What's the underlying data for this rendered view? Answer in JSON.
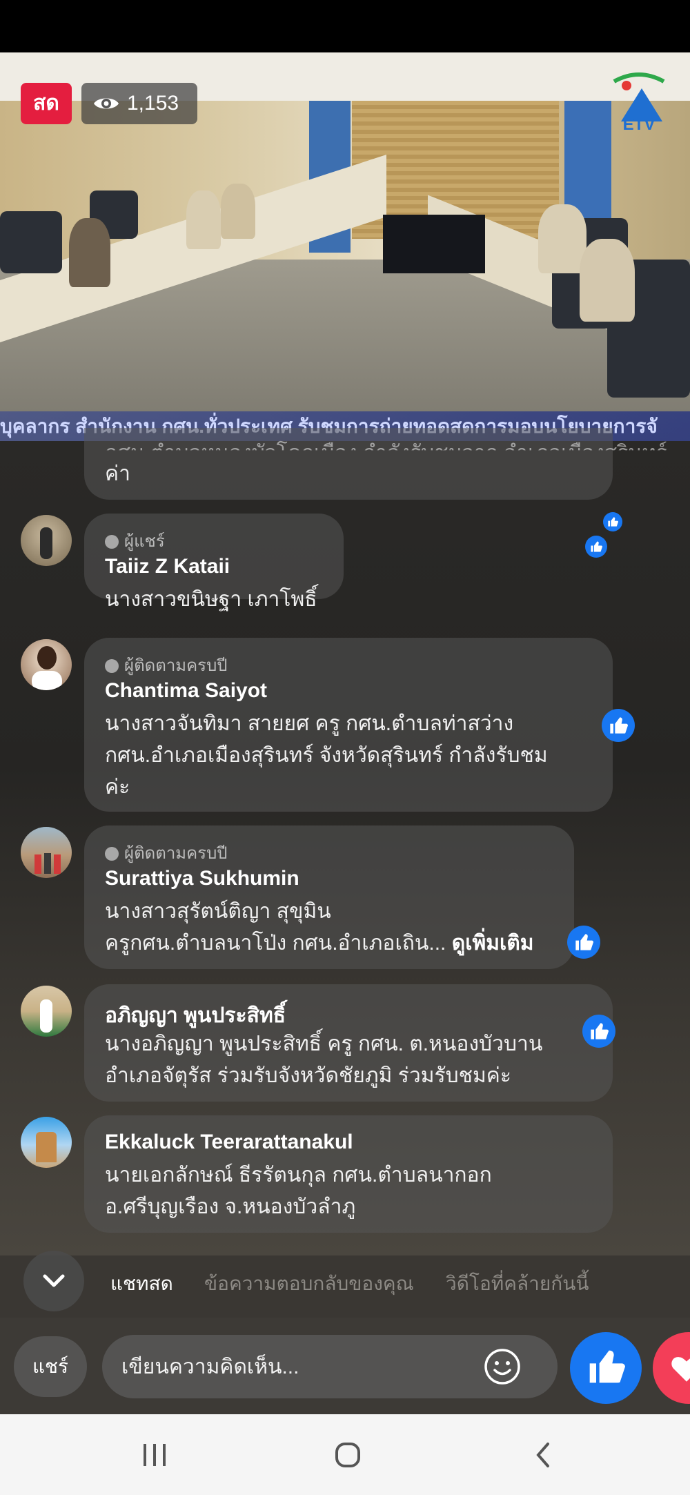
{
  "live": {
    "live_label": "สด",
    "viewer_count": "1,153",
    "channel_logo_text": "ETV",
    "ticker_text": "บุคลากร สำนักงาน กศน.ทั่วประเทศ รับชมการถ่ายทอดสดการมอบนโยบายการจั"
  },
  "comments": [
    {
      "partial_top_line": "กศน.ตำบลหนองบัวโคกเมือง กำลังรับชมจาก อำเภอเมืองสุรินทร์",
      "line2": "ค่า"
    },
    {
      "badge": "ผู้แชร์",
      "author": "Taiiz Z Kataii",
      "lines": [
        "นางสาวขนิษฐา เภาโพธิ์"
      ]
    },
    {
      "badge": "ผู้ติดตามครบปี",
      "author": "Chantima Saiyot",
      "lines": [
        "นางสาวจันทิมา สายยศ ครู กศน.ตำบลท่าสว่าง",
        "กศน.อำเภอเมืองสุรินทร์   จังหวัดสุรินทร์ กำลังรับชม",
        "ค่ะ"
      ]
    },
    {
      "badge": "ผู้ติดตามครบปี",
      "author": "Surattiya Sukhumin",
      "lines": [
        "นางสาวสุรัตน์ติญา  สุขุมิน",
        "ครูกศน.ตำบลนาโป่ง กศน.อำเภอเถิน... "
      ],
      "see_more": "ดูเพิ่มเติม"
    },
    {
      "author": "อภิญญา พูนประสิทธิ์",
      "lines": [
        "นางอภิญญา พูนประสิทธิ์ ครู กศน. ต.หนองบัวบาน",
        "อำเภอจัตุรัส ร่วมรับจังหวัดชัยภูมิ ร่วมรับชมค่ะ"
      ]
    },
    {
      "author": "Ekkaluck Teerarattanakul",
      "lines": [
        "นายเอกลักษณ์ ธีรรัตนกุล กศน.ตำบลนากอก",
        "อ.ศรีบุญเรือง จ.หนองบัวลำภู"
      ]
    }
  ],
  "tabs": [
    "แชทสด",
    "ข้อความตอบกลับของคุณ",
    "วิดีโอที่คล้ายกันนี้"
  ],
  "composer": {
    "share_label": "แชร์",
    "comment_placeholder": "เขียนความคิดเห็น..."
  },
  "icons": {
    "eye": "eye-icon",
    "chevron": "chevron-down-icon",
    "emoji": "emoji-icon",
    "like": "thumbs-up-icon",
    "heart": "heart-icon",
    "recents": "recent-apps-icon",
    "home": "home-icon",
    "back": "back-icon"
  },
  "colors": {
    "live_red": "#e41e3f",
    "facebook_blue": "#1877f2",
    "love_red": "#f33e58"
  }
}
